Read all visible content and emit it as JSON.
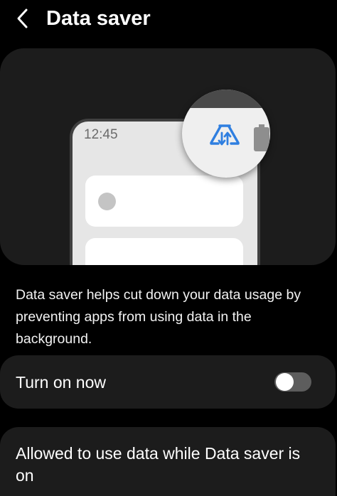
{
  "header": {
    "title": "Data saver",
    "back_icon": "chevron-left-icon"
  },
  "illustration": {
    "phone_time": "12:45",
    "status_icon": "data-saver-icon",
    "battery_icon": "battery-icon",
    "accent_color": "#2f7fe0"
  },
  "description": "Data saver helps cut down your data usage by preventing apps from using data in the background.",
  "turn_on_now": {
    "label": "Turn on now",
    "enabled": false
  },
  "allowed": {
    "label": "Allowed to use data while Data saver is on"
  },
  "colors": {
    "background": "#000000",
    "card": "#1c1c1c",
    "switch_track_off": "#5d5d5d"
  }
}
